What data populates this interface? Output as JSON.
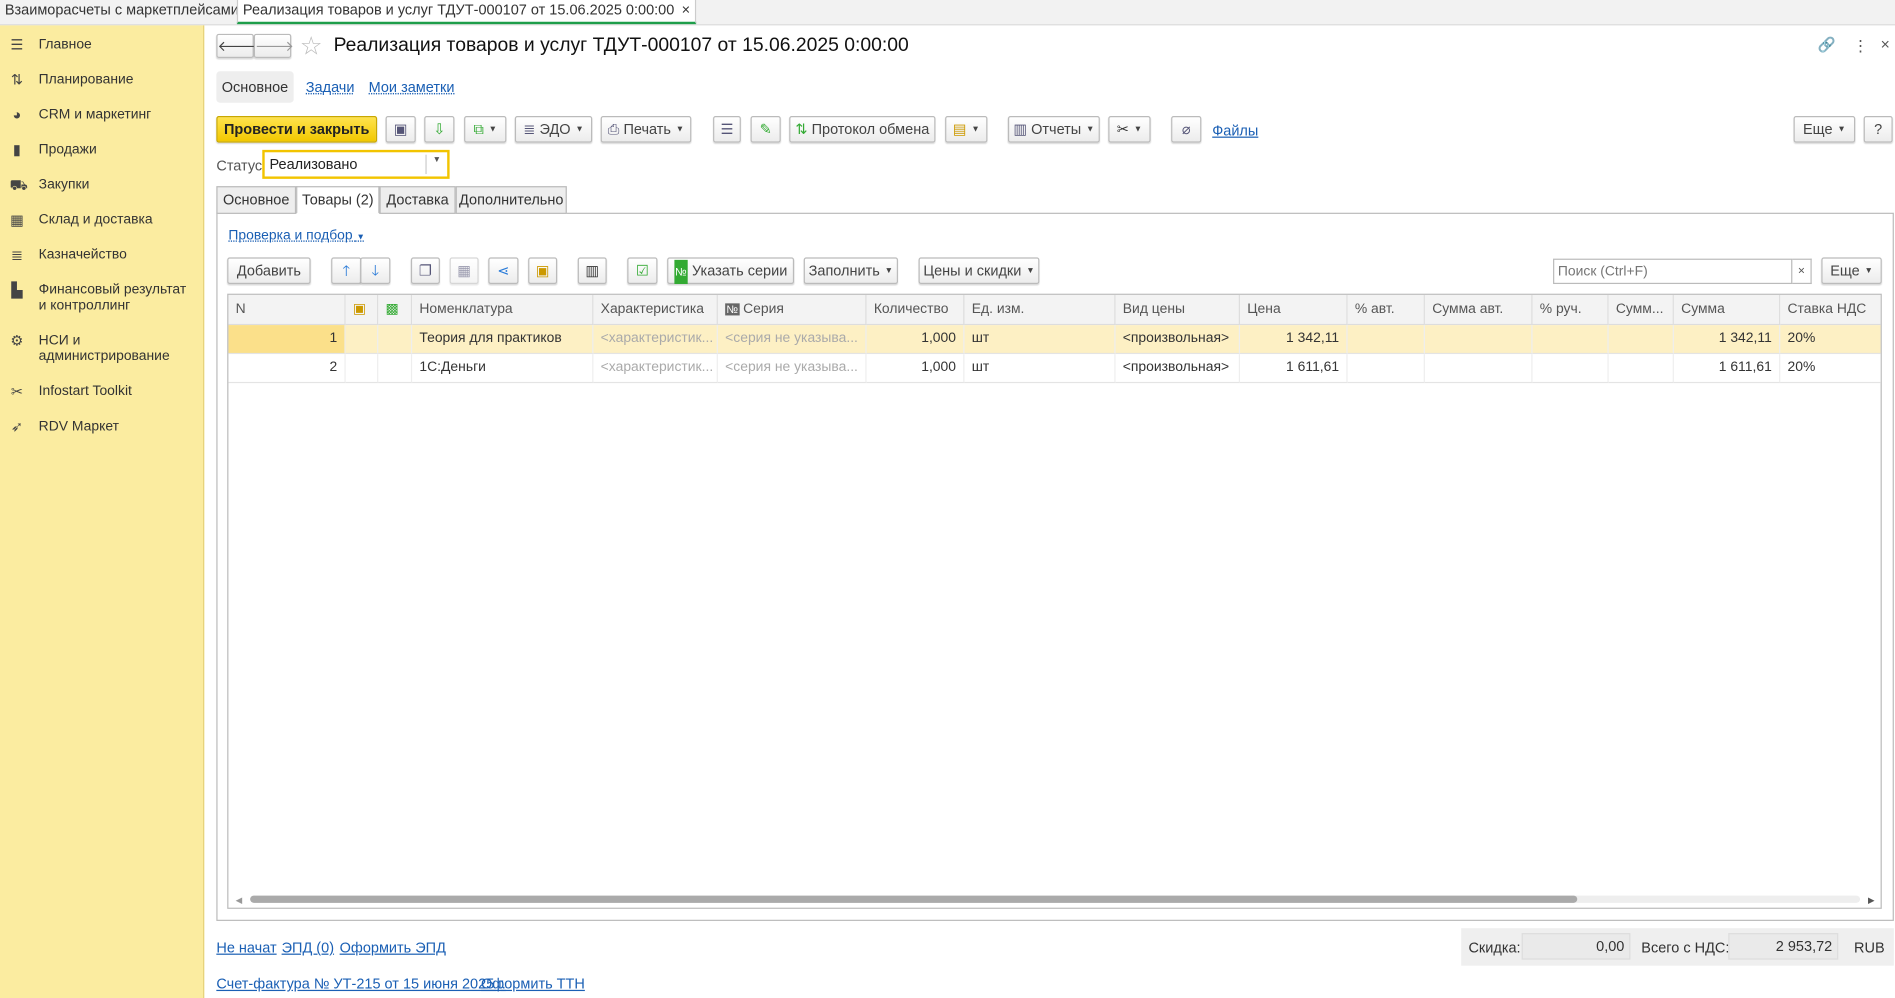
{
  "window_tabs": [
    {
      "label": "Взаиморасчеты с маркетплейсами",
      "close": "×"
    },
    {
      "label": "Реализация товаров и услуг ТДУТ-000107 от 15.06.2025 0:00:00",
      "close": "×"
    }
  ],
  "sidebar": {
    "items": [
      {
        "icon": "☰",
        "label": "Главное"
      },
      {
        "icon": "⇅",
        "label": "Планирование"
      },
      {
        "icon": "◕",
        "label": "CRM и маркетинг"
      },
      {
        "icon": "▮",
        "label": "Продажи"
      },
      {
        "icon": "⛟",
        "label": "Закупки"
      },
      {
        "icon": "▦",
        "label": "Склад и доставка"
      },
      {
        "icon": "≣",
        "label": "Казначейство"
      },
      {
        "icon": "▙",
        "label": "Финансовый результат и контроллинг"
      },
      {
        "icon": "⚙",
        "label": "НСИ и администрирование"
      },
      {
        "icon": "✂",
        "label": "Infostart Toolkit"
      },
      {
        "icon": "➶",
        "label": "RDV Маркет"
      }
    ]
  },
  "header": {
    "title": "Реализация товаров и услуг ТДУТ-000107 от 15.06.2025 0:00:00",
    "back": "🡐",
    "forward": "🡒",
    "star": "☆",
    "link": "🔗",
    "more": "⋮",
    "close": "×"
  },
  "form_tabs": [
    "Основное",
    "Задачи",
    "Мои заметки"
  ],
  "toolbar": {
    "post_close": "Провести и закрыть",
    "edo": "ЭДО",
    "print": "Печать",
    "exchange_log": "Протокол обмена",
    "reports": "Отчеты",
    "files": "Файлы",
    "more": "Еще",
    "help": "?"
  },
  "status": {
    "label": "Статус:",
    "value": "Реализовано"
  },
  "inner_tabs": [
    "Основное",
    "Товары (2)",
    "Доставка",
    "Дополнительно"
  ],
  "goods": {
    "check_link": "Проверка и подбор",
    "add": "Добавить",
    "set_series": "Указать серии",
    "fill": "Заполнить",
    "prices": "Цены и скидки",
    "search_placeholder": "Поиск (Ctrl+F)",
    "search_clear": "×",
    "more": "Еще",
    "columns": [
      "N",
      "",
      "",
      "Номенклатура",
      "Характеристика",
      "Серия",
      "Количество",
      "Ед. изм.",
      "Вид цены",
      "Цена",
      "% авт.",
      "Сумма авт.",
      "% руч.",
      "Сумм...",
      "Сумма",
      "Ставка НДС"
    ],
    "rows": [
      {
        "n": "1",
        "name": "Теория для практиков",
        "char": "<характеристик...",
        "series": "<серия не указыва...",
        "qty": "1,000",
        "unit": "шт",
        "price_type": "<произвольная>",
        "price": "1 342,11",
        "pa": "",
        "sa": "",
        "pm": "",
        "sm": "",
        "sum": "1 342,11",
        "vat": "20%"
      },
      {
        "n": "2",
        "name": "1С:Деньги",
        "char": "<характеристик...",
        "series": "<серия не указыва...",
        "qty": "1,000",
        "unit": "шт",
        "price_type": "<произвольная>",
        "price": "1 611,61",
        "pa": "",
        "sa": "",
        "pm": "",
        "sm": "",
        "sum": "1 611,61",
        "vat": "20%"
      }
    ]
  },
  "footer": {
    "not_started": "Не начат",
    "epd": "ЭПД (0)",
    "make_epd": "Оформить ЭПД",
    "invoice": "Счет-фактура № УТ-215 от 15 июня 2025 г.",
    "make_ttn": "Оформить ТТН",
    "discount_label": "Скидка:",
    "discount": "0,00",
    "total_label": "Всего с НДС:",
    "total": "2 953,72",
    "currency": "RUB"
  }
}
